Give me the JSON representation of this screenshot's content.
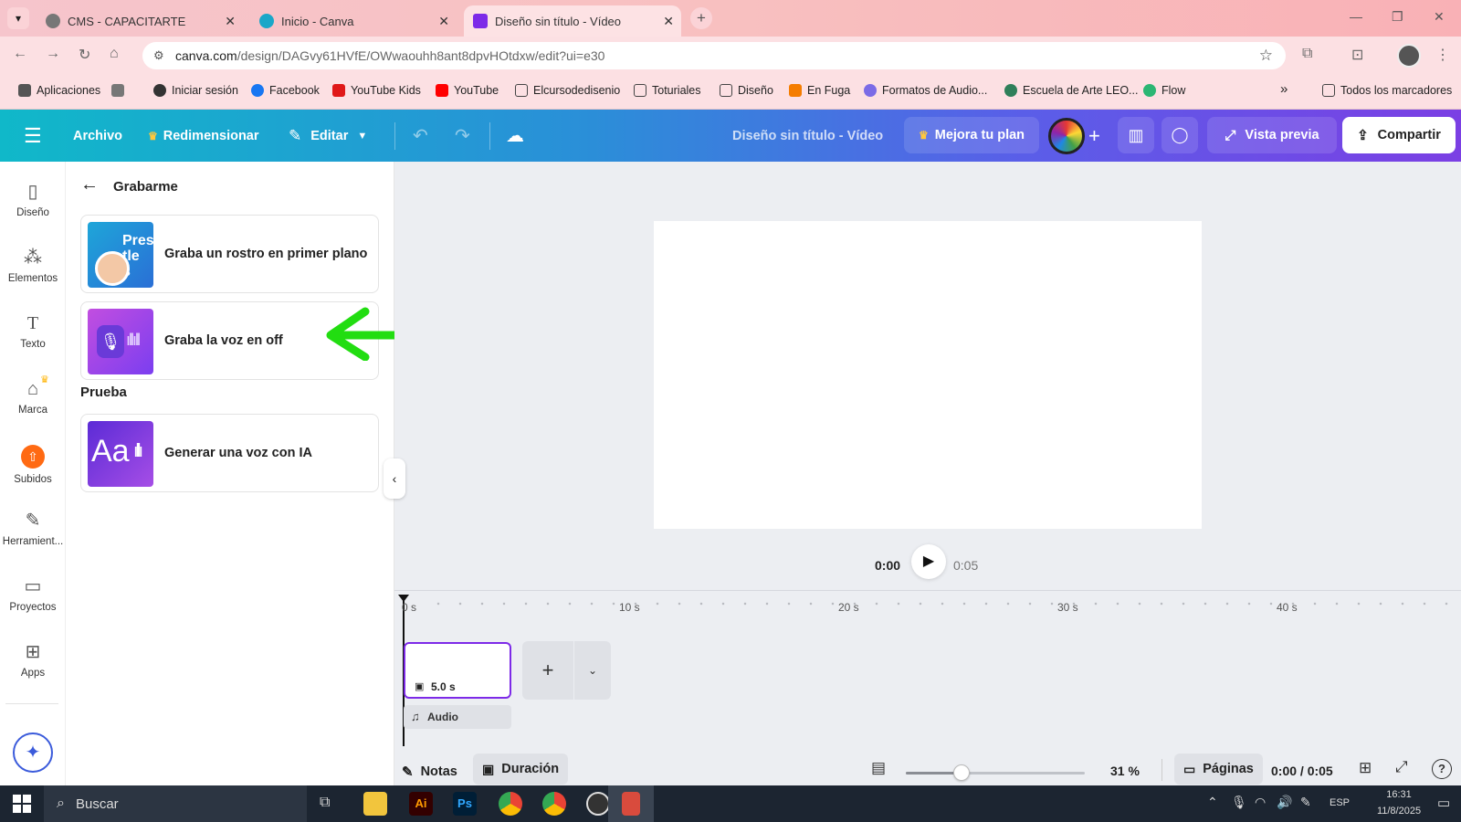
{
  "browser": {
    "tabs": [
      {
        "title": "CMS - CAPACITARTE",
        "active": false
      },
      {
        "title": "Inicio - Canva",
        "active": false
      },
      {
        "title": "Diseño sin título - Vídeo",
        "active": true
      }
    ],
    "url": "canva.com/design/DAGvy61HVfE/OWwaouhh8ant8dpvHOtdxw/edit?ui=e30",
    "url_host": "canva.com",
    "url_path": "/design/DAGvy61HVfE/OWwaouhh8ant8dpvHOtdxw/edit?ui=e30"
  },
  "bookmarks": {
    "items": [
      "Aplicaciones",
      "Iniciar sesión",
      "Facebook",
      "YouTube Kids",
      "YouTube",
      "Elcursodedisenio",
      "Toturiales",
      "Diseño",
      "En Fuga",
      "Formatos de Audio...",
      "Escuela de Arte LEO...",
      "Flow"
    ],
    "more": "»",
    "all": "Todos los marcadores"
  },
  "canva_header": {
    "archivo": "Archivo",
    "redimensionar": "Redimensionar",
    "editar": "Editar",
    "title": "Diseño sin título - Vídeo",
    "mejora": "Mejora tu plan",
    "vista_previa": "Vista previa",
    "compartir": "Compartir"
  },
  "rail": {
    "items": [
      "Diseño",
      "Elementos",
      "Texto",
      "Marca",
      "Subidos",
      "Herramient...",
      "Proyectos",
      "Apps"
    ]
  },
  "panel": {
    "back_title": "Grabarme",
    "cards": [
      {
        "label": "Graba un rostro en primer plano"
      },
      {
        "label": "Graba la voz en off"
      }
    ],
    "section": "Prueba",
    "ai_card": {
      "label": "Generar una voz con IA"
    },
    "thumb_text": "Pres tle s",
    "ai_thumb_text": "Aa"
  },
  "player": {
    "current": "0:00",
    "total": "0:05"
  },
  "timeline": {
    "ticks": [
      "0 s",
      "10 s",
      "20 s",
      "30 s",
      "40 s"
    ],
    "clip_duration": "5.0 s",
    "audio_label": "Audio"
  },
  "footer": {
    "notas": "Notas",
    "duracion": "Duración",
    "zoom": "31 %",
    "zoom_fraction": 0.31,
    "paginas": "Páginas",
    "time": "0:00 / 0:05",
    "help": "?"
  },
  "taskbar": {
    "search": "Buscar",
    "lang": "ESP",
    "time": "16:31",
    "date": "11/8/2025"
  },
  "colors": {
    "arrow": "#22dd11",
    "accent": "#7d2ae8"
  }
}
